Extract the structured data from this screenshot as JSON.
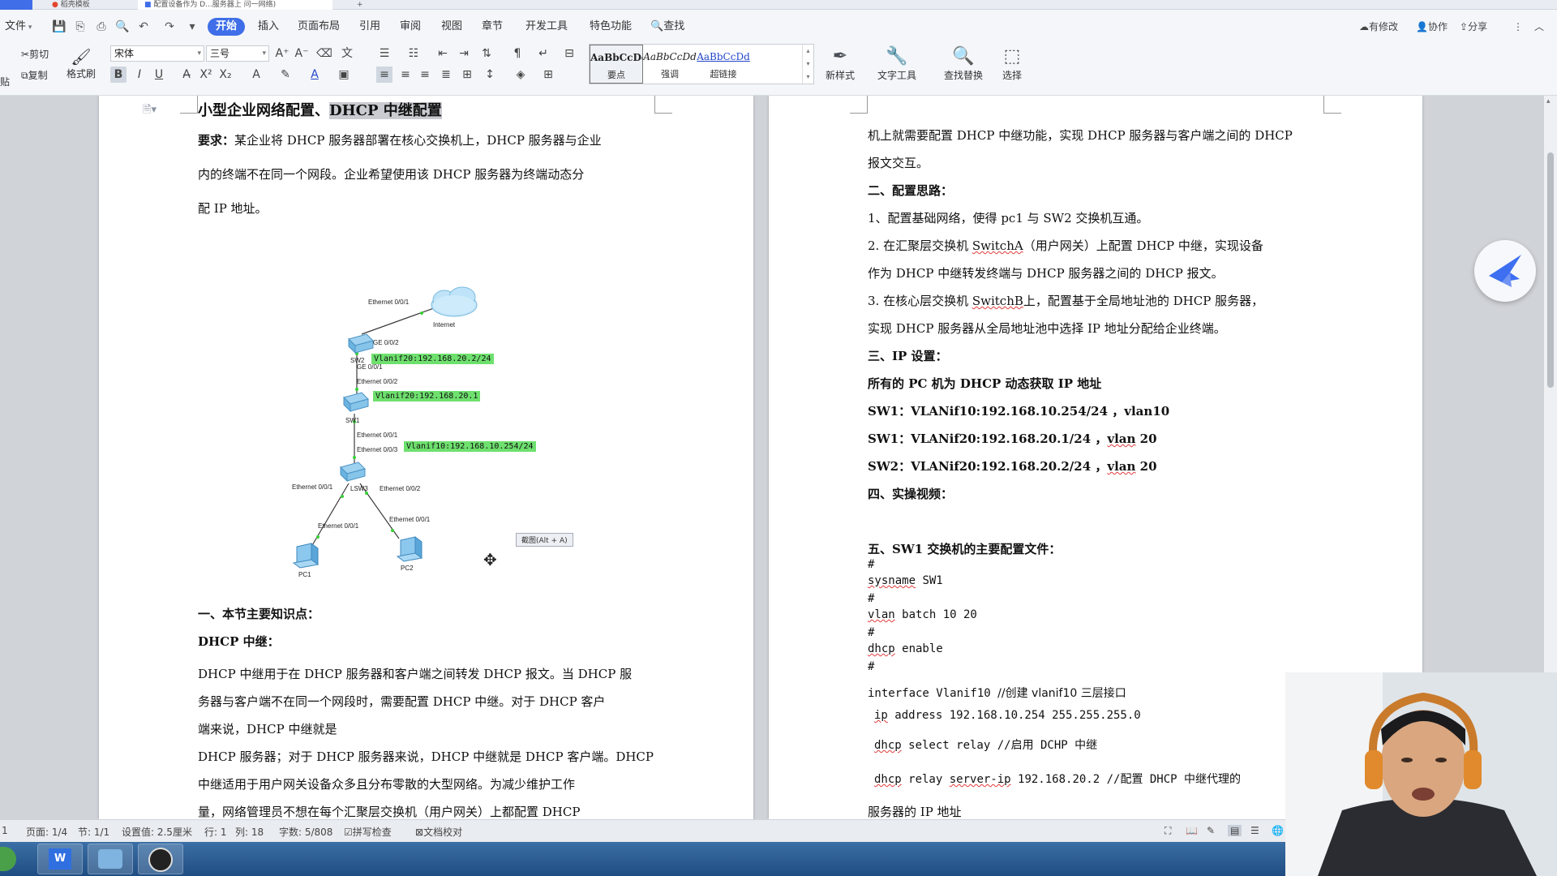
{
  "titlebar": {
    "tabs": [
      {
        "label": "稻壳模板"
      },
      {
        "label": "配置设备作为 D...服务器上 问一网络)"
      }
    ]
  },
  "menu": {
    "file": "文件",
    "tabs": [
      "开始",
      "插入",
      "页面布局",
      "引用",
      "审阅",
      "视图",
      "章节",
      "开发工具",
      "特色功能"
    ],
    "search": "查找",
    "right_actions": [
      "有修改",
      "协作",
      "分享"
    ]
  },
  "ribbon": {
    "cut": "剪切",
    "copy": "复制",
    "format_painter": "格式刷",
    "paste_fragment": "贴",
    "font_name": "宋体",
    "font_size": "三号",
    "styles": [
      {
        "sample": "AaBbCcDd",
        "name": "要点"
      },
      {
        "sample": "AaBbCcDd",
        "name": "强调"
      },
      {
        "sample": "AaBbCcDd",
        "name": "超链接"
      }
    ],
    "new_style": "新样式",
    "text_tools": "文字工具",
    "find_replace": "查找替换",
    "select": "选择"
  },
  "doc": {
    "title_part1": "小型企业网络配置、",
    "title_part2": "DHCP 中继配置",
    "req_label": "要求：",
    "req_line1": "某企业将 DHCP 服务器部署在核心交换机上，DHCP 服务器与企业",
    "req_line2": "内的终端不在同一个网段。企业希望使用该 DHCP 服务器为终端动态分",
    "req_line3": "配 IP 地址。",
    "topology": {
      "cloud_label": "Internet",
      "sw2_label": "SW2",
      "sw1_label": "SW1",
      "lsw3_label": "LSW3",
      "pc1_label": "PC1",
      "pc2_label": "PC2",
      "port_labels": [
        "Ethernet 0/0/1",
        "GE 0/0/2",
        "GE 0/0/1",
        "Ethernet 0/0/2",
        "Ethernet 0/0/1",
        "Ethernet 0/0/3",
        "Ethernet 0/0/1",
        "Ethernet 0/0/2",
        "Ethernet 0/0/1",
        "Ethernet 0/0/1"
      ],
      "vlan_tags": [
        "Vlanif20:192.168.20.2/24",
        "Vlanif20:192.168.20.1",
        "Vlanif10:192.168.10.254/24"
      ]
    },
    "screenshot_tip": "截图(Alt + A)",
    "sec1_title": "一、本节主要知识点：",
    "sec1_sub": "DHCP 中继：",
    "sec1_p1": "DHCP 中继用于在 DHCP 服务器和客户端之间转发 DHCP 报文。当 DHCP 服",
    "sec1_p2": "务器与客户端不在同一个网段时，需要配置 DHCP 中继。对于 DHCP 客户",
    "sec1_p3": "端来说，DHCP 中继就是",
    "sec1_p4": "DHCP 服务器；对于 DHCP 服务器来说，DHCP 中继就是 DHCP 客户端。DHCP",
    "sec1_p5": "中继适用于用户网关设备众多且分布零散的大型网络。为减少维护工作",
    "sec1_p6": "量，网络管理员不想在每个汇聚层交换机（用户网关）上都配置 DHCP",
    "right_p1": "机上就需要配置 DHCP 中继功能，实现 DHCP 服务器与客户端之间的 DHCP",
    "right_p2": "报文交互。",
    "sec2_title": "二、配置思路：",
    "sec2_l1": "1、配置基础网络，使得 pc1 与 SW2 交换机互通。",
    "sec2_l2a": "2. 在汇聚层交换机 ",
    "sec2_l2b": "SwitchA",
    "sec2_l2c": "（用户网关）上配置 DHCP 中继，实现设备",
    "sec2_l3": "作为 DHCP 中继转发终端与 DHCP 服务器之间的 DHCP 报文。",
    "sec2_l4a": "3. 在核心层交换机 ",
    "sec2_l4b": "SwitchB",
    "sec2_l4c": "上，配置基于全局地址池的 DHCP 服务器，",
    "sec2_l5": "实现 DHCP 服务器从全局地址池中选择 IP 地址分配给企业终端。",
    "sec3_title": "三、IP 设置：",
    "sec3_l1": "所有的 PC 机为 DHCP 动态获取 IP 地址",
    "sec3_l2": "SW1：VLANif10:192.168.10.254/24 ，vlan10",
    "sec3_l3a": "SW1：VLANif20:192.168.20.1/24 ，",
    "sec3_l3b": "vlan",
    "sec3_l3c": " 20",
    "sec3_l4a": "SW2：VLANif20:192.168.20.2/24 ，",
    "sec3_l4b": "vlan",
    "sec3_l4c": " 20",
    "sec4_title": "四、实操视频：",
    "sec5_title": "五、SW1 交换机的主要配置文件：",
    "cfg": {
      "hash": "#",
      "sysname_kw": "sysname",
      "sysname_val": " SW1",
      "vlan_kw": "vlan",
      "vlan_val": " batch 10 20",
      "dhcp_kw": "dhcp",
      "dhcp_val": " enable",
      "iface": "interface Vlanif10 ",
      "iface_comment": " //创建 vlanif10 三层接口",
      "ip_kw": "ip",
      "ip_val": " address 192.168.10.254 255.255.255.0",
      "relay_kw": "dhcp",
      "relay_val": " select relay //启用 DCHP 中继",
      "server_kw1": "dhcp",
      "server_mid": " relay ",
      "server_kw2": "server-ip",
      "server_val": " 192.168.20.2 //配置 DHCP 中继代理的",
      "server_tail": "服务器的 IP 地址"
    }
  },
  "status": {
    "first": "1",
    "page": "页面: 1/4",
    "section": "节: 1/1",
    "setting": "设置值: 2.5厘米",
    "row": "行: 1",
    "col": "列: 18",
    "words": "字数: 5/808",
    "spell": "拼写检查",
    "proof": "文档校对"
  },
  "colors": {
    "accent": "#3f6ee8",
    "vlan_tag": "#6ee06e",
    "selection": "#c9cbd0"
  }
}
